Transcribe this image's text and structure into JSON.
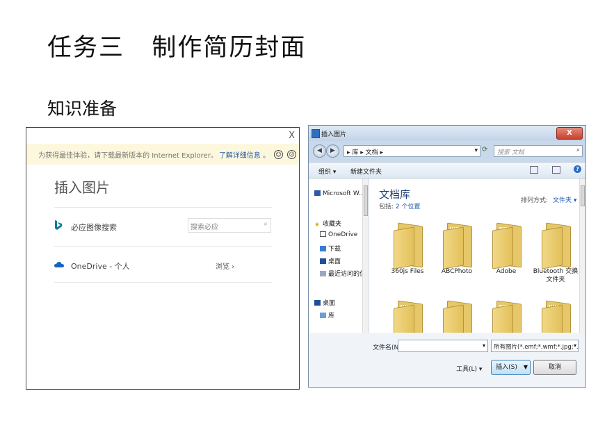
{
  "slide": {
    "title": "任务三   制作简历封面",
    "subtitle": "知识准备"
  },
  "web_dialog": {
    "close": "X",
    "notice": "为获得最佳体验，请下载最新版本的 Internet Explorer。",
    "notice_link": "了解详细信息 。",
    "heading": "插入图片",
    "rows": [
      {
        "icon": "bing-icon",
        "label": "必应图像搜索",
        "search_placeholder": "搜索必应"
      },
      {
        "icon": "onedrive-icon",
        "label": "OneDrive - 个人",
        "action": "浏览 ›"
      }
    ]
  },
  "file_dialog": {
    "title": "插入图片",
    "close": "X",
    "path": "▸ 库 ▸ 文档 ▸",
    "search_placeholder": "搜索 文档",
    "toolbar": {
      "organize": "组织 ▾",
      "new_folder": "新建文件夹"
    },
    "nav_items": [
      "Microsoft W...",
      "收藏夹",
      "OneDrive",
      "下载",
      "桌面",
      "最近访问的位",
      "桌面",
      "库"
    ],
    "library_title": "文档库",
    "library_sub": "包括:",
    "library_link": "2 个位置",
    "sort_label": "排列方式:",
    "sort_value": "文件夹 ▾",
    "folders": [
      "360js Files",
      "ABCPhoto",
      "Adobe",
      "Bluetooth 交换\n文件夹"
    ],
    "filename_label": "文件名(N):",
    "filter": "所有图片(*.emf;*.wmf;*.jpg;*.jp",
    "tools": "工具(L)  ▾",
    "insert": "插入(S)",
    "cancel": "取消"
  }
}
